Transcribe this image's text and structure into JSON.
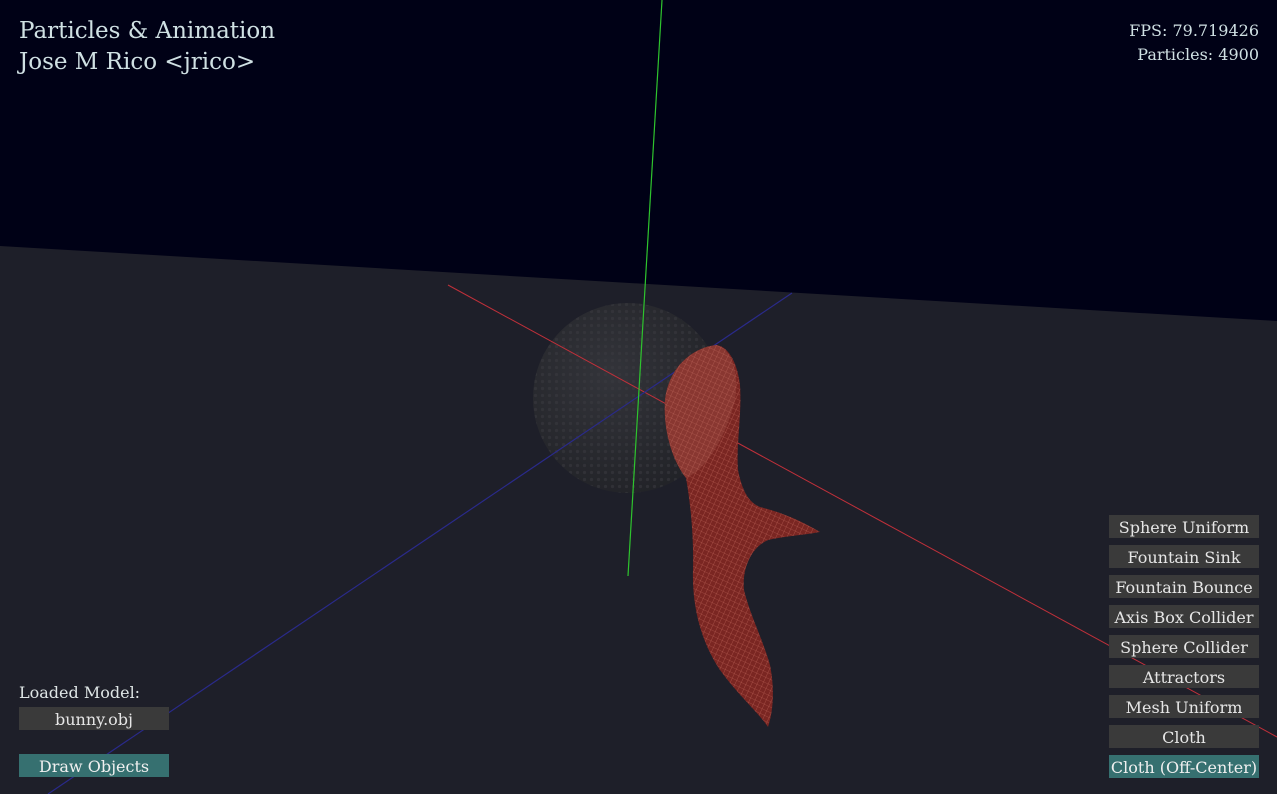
{
  "window": {
    "title": "Particles & Animation",
    "author": "Jose M Rico <jrico>"
  },
  "stats": {
    "fps": "FPS: 79.719426",
    "particles": "Particles: 4900"
  },
  "model": {
    "label": "Loaded Model:",
    "value": "bunny.obj"
  },
  "toggles": {
    "draw_objects": "Draw Objects",
    "draw_objects_active": true
  },
  "scene_buttons": [
    {
      "label": "Sphere Uniform",
      "active": false
    },
    {
      "label": "Fountain Sink",
      "active": false
    },
    {
      "label": "Fountain Bounce",
      "active": false
    },
    {
      "label": "Axis Box Collider",
      "active": false
    },
    {
      "label": "Sphere Collider",
      "active": false
    },
    {
      "label": "Attractors",
      "active": false
    },
    {
      "label": "Mesh Uniform",
      "active": false
    },
    {
      "label": "Cloth",
      "active": false
    },
    {
      "label": "Cloth (Off-Center)",
      "active": true
    }
  ],
  "colors": {
    "sky": "#000116",
    "ground": "#1e1f29",
    "axis_x": "#c0303a",
    "axis_y": "#2ec42e",
    "axis_z": "#2a2a8a",
    "cloth": "#8a2a26",
    "cloth_mesh": "#d06a5e",
    "sphere": "#2c2c30",
    "button_bg": "#3a3a3a",
    "button_active_bg": "#367070"
  }
}
